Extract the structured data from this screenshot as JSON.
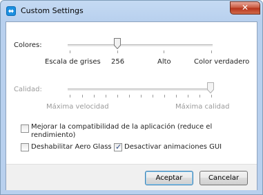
{
  "window": {
    "title": "Custom Settings",
    "close_glyph": "✕"
  },
  "colors": {
    "label": "Colores:",
    "options": [
      "Escala de grises",
      "256",
      "Alto",
      "Color verdadero"
    ],
    "selected_index": 1
  },
  "quality": {
    "label": "Calidad:",
    "min_label": "Máxima velocidad",
    "max_label": "Máxima calidad",
    "value_fraction": 1.0,
    "enabled": false
  },
  "options": {
    "compat_line1": "Mejorar la compatibilidad de la aplicación (reduce el",
    "compat_line2": "rendimiento)",
    "compat_checked": false,
    "aero_label": "Deshabilitar Aero Glass",
    "aero_checked": false,
    "anim_label": "Desactivar animaciones GUI",
    "anim_checked": true,
    "check_glyph": "✓"
  },
  "buttons": {
    "ok": "Aceptar",
    "cancel": "Cancelar"
  },
  "theme": {
    "accent": "#1b8fe0",
    "close_red": "#c7553b",
    "frame": "#b8d0ee"
  }
}
